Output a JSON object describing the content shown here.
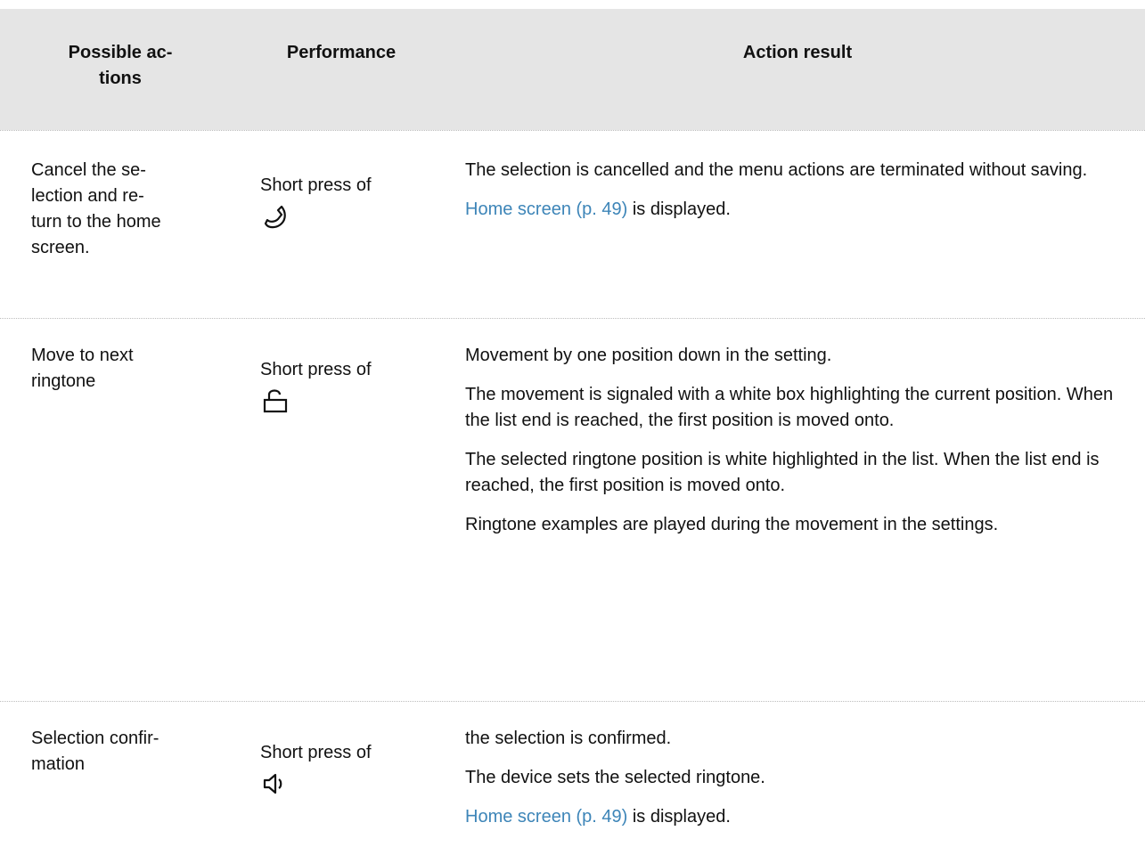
{
  "header": {
    "col1": "Possible ac-\ntions",
    "col2": "Performance",
    "col3": "Action result"
  },
  "rows": [
    {
      "action": "Cancel the se-\nlection and re-\nturn to the home\nscreen.",
      "performance": "Short press of",
      "icon": "handset-hangup-icon",
      "results": [
        {
          "text": "The selection is cancelled and the menu actions are terminated without saving."
        },
        {
          "link": "Home screen (p. 49)",
          "text": " is displayed."
        }
      ]
    },
    {
      "action": "Move to next\nringtone",
      "performance": "Short press of",
      "icon": "lock-icon",
      "results": [
        {
          "text": "Movement by one position down in the setting."
        },
        {
          "text": "The movement is signaled with a white box highlighting the current position. When the list end is reached, the first position is moved onto."
        },
        {
          "text": "The selected ringtone position is white highlighted in the list. When the list end is reached, the first position is moved onto."
        },
        {
          "text": "Ringtone examples are played during the movement in the settings."
        }
      ]
    },
    {
      "action": "Selection confir-\nmation",
      "performance": "Short press of",
      "icon": "speaker-icon",
      "results": [
        {
          "text": "the selection is confirmed."
        },
        {
          "text": "The device sets the selected ringtone."
        },
        {
          "link": "Home screen (p. 49)",
          "text": " is displayed."
        }
      ]
    }
  ],
  "colors": {
    "header_bg": "#e5e5e5",
    "link": "#3d85b8",
    "separator": "#bdbdbd"
  }
}
